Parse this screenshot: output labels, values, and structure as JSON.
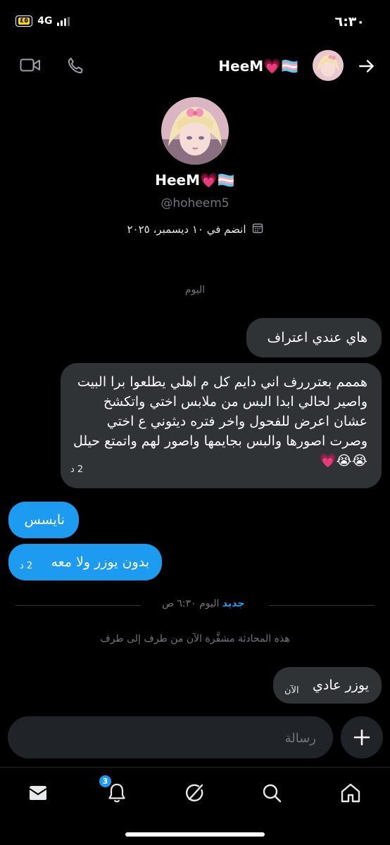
{
  "status_bar": {
    "time": "٦:٣٠",
    "network": "4G",
    "battery": "٤٥"
  },
  "header": {
    "name": "HeeM💗🏳️‍⚧️",
    "back_icon": "arrow-right-icon",
    "video_icon": "video-icon",
    "call_icon": "phone-icon"
  },
  "profile": {
    "name": "HeeM💗🏳️‍⚧️",
    "handle": "@hoheem5",
    "joined": "انضم في ١٠ ديسمبر، ٢٠٢٥",
    "calendar_icon": "calendar-icon"
  },
  "chat": {
    "day_separator": "اليوم",
    "messages": [
      {
        "text": "هاي عندي اعتراف",
        "meta": ""
      },
      {
        "text": "هممم بعترررف اني دايم كل م اهلي يطلعوا برا البيت واصير لحالي ابدا البس من ملابس اختي واتكشخ عشان اعرض للفحول واخر فتره ديثوني ع اختي وصرت اصورها والبس بجايمها واصور لهم واتمتع حيلل 😭😭💗",
        "meta": "2 د"
      },
      {
        "text": "نايسس",
        "meta": ""
      },
      {
        "text": "بدون يوزر ولا معه",
        "meta": "2 د"
      }
    ],
    "new_divider": {
      "label": "جديد",
      "time": "اليوم ٦:٣٠ ص"
    },
    "encryption_notice": "هذه المحادثة مشفَّرة الآن من طرف إلى طرف",
    "last_message": {
      "text": "يوزر عادي",
      "meta": "الآن"
    }
  },
  "composer": {
    "placeholder": "رسالة",
    "add_icon": "plus-icon"
  },
  "nav": {
    "items": [
      "mail-icon",
      "bell-icon",
      "grok-icon",
      "search-icon",
      "home-icon"
    ],
    "notification_count": "3"
  },
  "colors": {
    "accent": "#1d9bf0",
    "bubble_in": "#2f3336",
    "background": "#000000"
  }
}
